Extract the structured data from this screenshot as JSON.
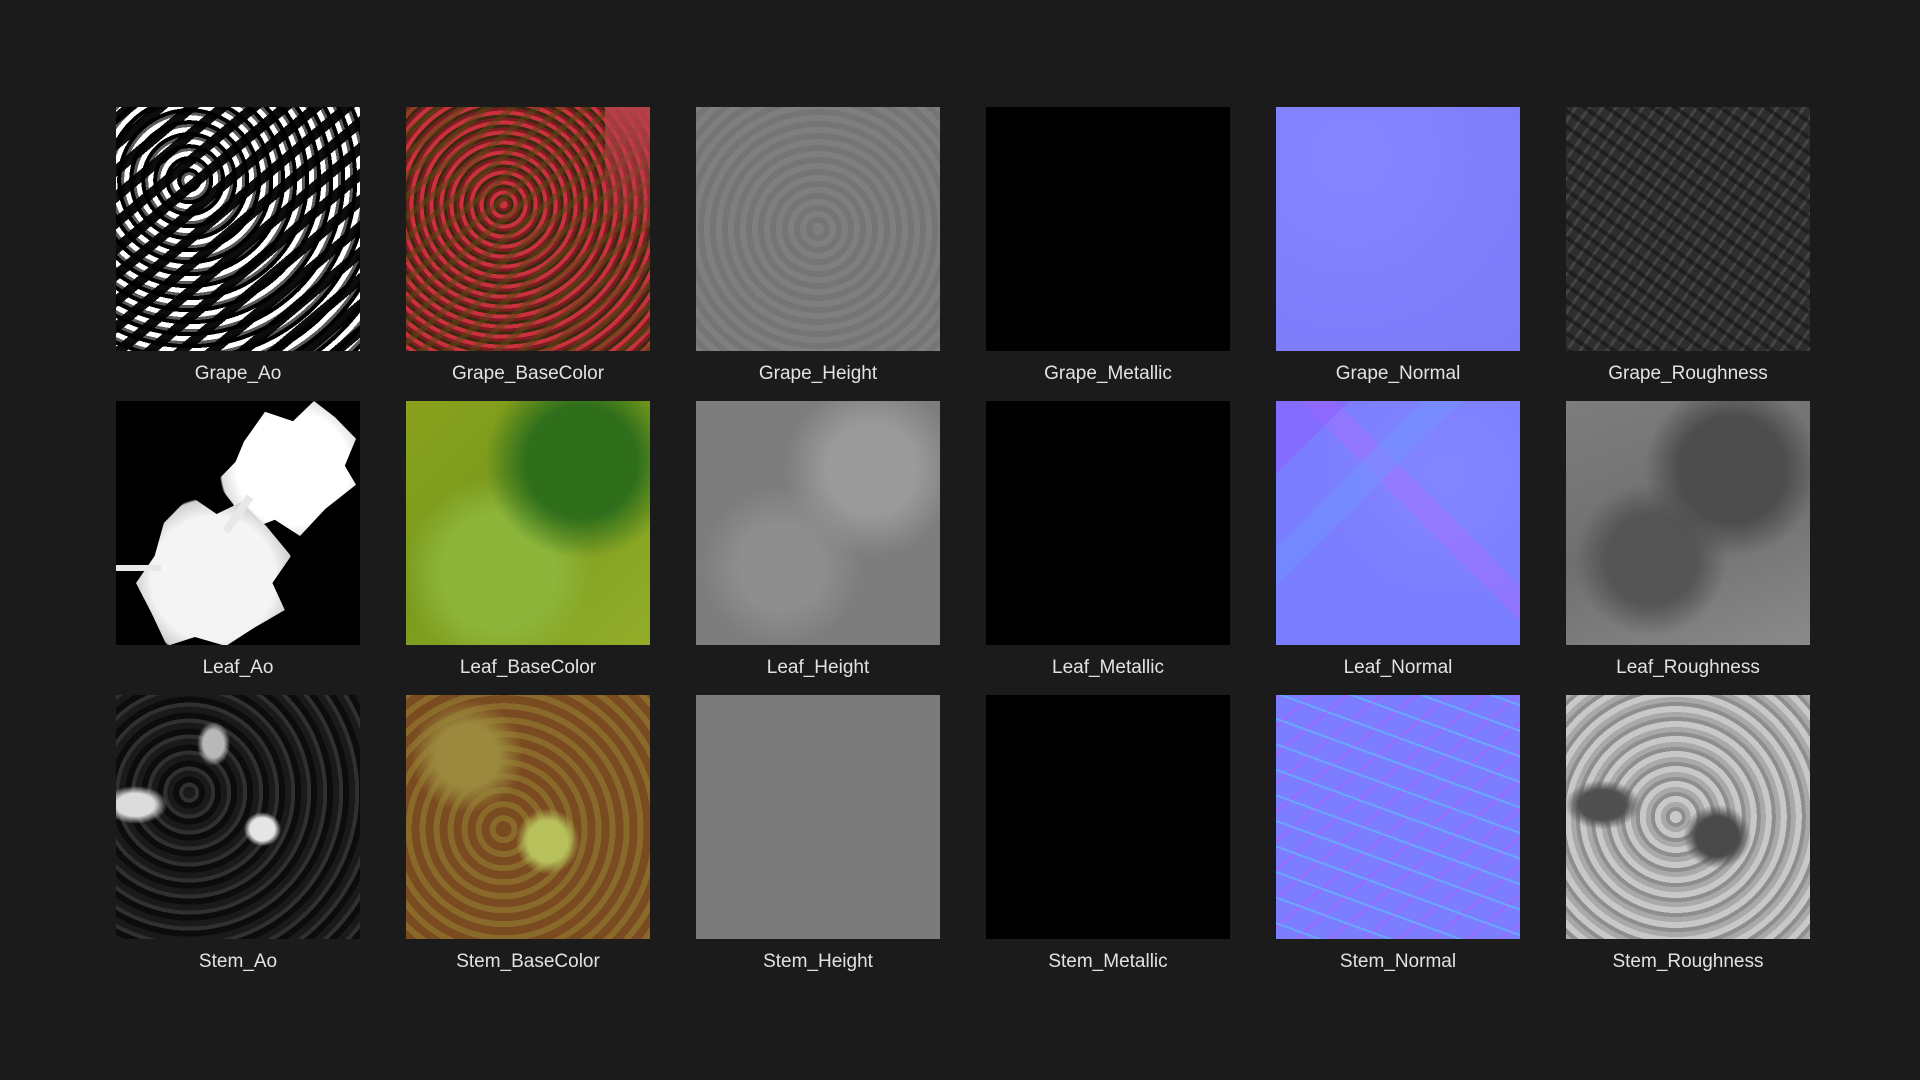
{
  "textures": [
    {
      "label": "Grape_Ao",
      "kind": "grape-ao"
    },
    {
      "label": "Grape_BaseColor",
      "kind": "grape-base"
    },
    {
      "label": "Grape_Height",
      "kind": "grape-height"
    },
    {
      "label": "Grape_Metallic",
      "kind": "metallic"
    },
    {
      "label": "Grape_Normal",
      "kind": "grape-normal"
    },
    {
      "label": "Grape_Roughness",
      "kind": "grape-rough"
    },
    {
      "label": "Leaf_Ao",
      "kind": "leaf-ao"
    },
    {
      "label": "Leaf_BaseColor",
      "kind": "leaf-base"
    },
    {
      "label": "Leaf_Height",
      "kind": "leaf-height"
    },
    {
      "label": "Leaf_Metallic",
      "kind": "metallic"
    },
    {
      "label": "Leaf_Normal",
      "kind": "leaf-normal"
    },
    {
      "label": "Leaf_Roughness",
      "kind": "leaf-rough"
    },
    {
      "label": "Stem_Ao",
      "kind": "stem-ao"
    },
    {
      "label": "Stem_BaseColor",
      "kind": "stem-base"
    },
    {
      "label": "Stem_Height",
      "kind": "stem-height"
    },
    {
      "label": "Stem_Metallic",
      "kind": "metallic"
    },
    {
      "label": "Stem_Normal",
      "kind": "stem-normal"
    },
    {
      "label": "Stem_Roughness",
      "kind": "stem-rough"
    }
  ]
}
